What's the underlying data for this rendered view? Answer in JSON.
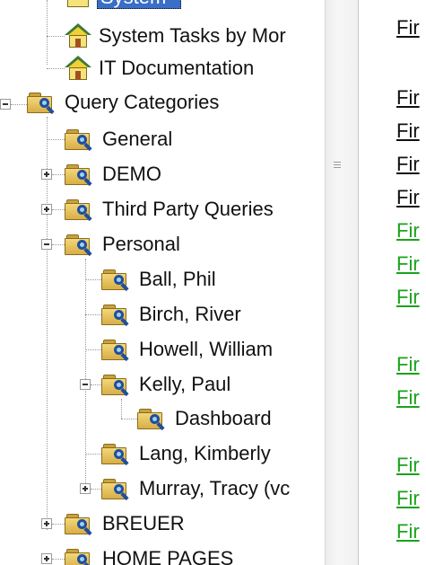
{
  "tree": {
    "selected_partial_label": "System",
    "nodes": [
      {
        "id": "system-tasks",
        "label": "System Tasks by Mor",
        "icon": "home-icon"
      },
      {
        "id": "it-docs",
        "label": "IT Documentation",
        "icon": "home-icon"
      },
      {
        "id": "query-categories",
        "label": "Query Categories",
        "icon": "query-folder-icon"
      },
      {
        "id": "general",
        "label": "General",
        "icon": "query-folder-icon"
      },
      {
        "id": "demo",
        "label": "DEMO",
        "icon": "query-folder-icon"
      },
      {
        "id": "third-party",
        "label": "Third Party Queries",
        "icon": "query-folder-icon"
      },
      {
        "id": "personal",
        "label": "Personal",
        "icon": "query-folder-icon"
      },
      {
        "id": "ball",
        "label": "Ball, Phil",
        "icon": "query-folder-icon"
      },
      {
        "id": "birch",
        "label": "Birch, River",
        "icon": "query-folder-icon"
      },
      {
        "id": "howell",
        "label": "Howell, William",
        "icon": "query-folder-icon"
      },
      {
        "id": "kelly",
        "label": "Kelly, Paul",
        "icon": "query-folder-icon"
      },
      {
        "id": "dashboard",
        "label": "Dashboard",
        "icon": "query-folder-icon"
      },
      {
        "id": "lang",
        "label": "Lang, Kimberly",
        "icon": "query-folder-icon"
      },
      {
        "id": "murray",
        "label": "Murray, Tracy (vc",
        "icon": "query-folder-icon"
      },
      {
        "id": "breuer",
        "label": "BREUER",
        "icon": "query-folder-icon"
      },
      {
        "id": "home-pages",
        "label": "HOME PAGES",
        "icon": "query-folder-icon"
      }
    ]
  },
  "right_links": {
    "black": [
      "Fir",
      "Fir",
      "Fir",
      "Fir",
      "Fir"
    ],
    "green": [
      "Fir",
      "Fir",
      "Fir",
      "Fir",
      "Fir",
      "Fir",
      "Fir",
      "Fir"
    ]
  },
  "colors": {
    "link_green": "#1aa31a",
    "selection": "#3a6ec7"
  }
}
